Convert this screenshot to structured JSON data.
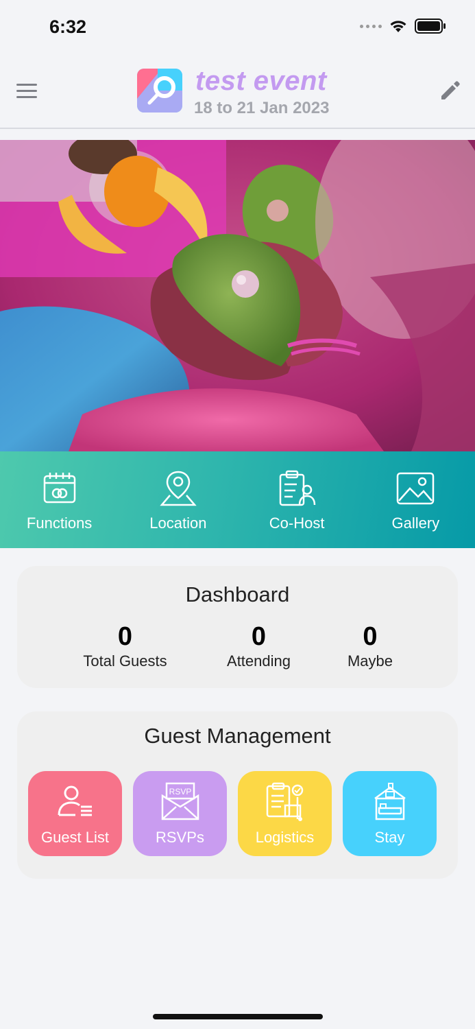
{
  "status_bar": {
    "time": "6:32",
    "icons": [
      "cellular-signal-icon",
      "wifi-icon",
      "battery-icon"
    ]
  },
  "header": {
    "title": "test event",
    "dates": "18 to 21 Jan 2023",
    "left_icon": "hamburger-menu-icon",
    "right_icon": "pencil-edit-icon",
    "logo_icon": "app-logo-icon",
    "title_color": "#c39af0"
  },
  "hero": {
    "icon": "wedding-photo-banner"
  },
  "quick_nav": {
    "items": [
      {
        "label": "Functions",
        "icon": "calendar-rings-icon"
      },
      {
        "label": "Location",
        "icon": "map-pin-icon"
      },
      {
        "label": "Co-Host",
        "icon": "clipboard-person-icon"
      },
      {
        "label": "Gallery",
        "icon": "image-icon"
      }
    ],
    "gradient": [
      "#4ec9ad",
      "#069aa7"
    ]
  },
  "dashboard": {
    "title": "Dashboard",
    "stats": [
      {
        "value": "0",
        "label": "Total Guests"
      },
      {
        "value": "0",
        "label": "Attending"
      },
      {
        "value": "0",
        "label": "Maybe"
      }
    ]
  },
  "guest_management": {
    "title": "Guest Management",
    "tiles": [
      {
        "label": "Guest List",
        "icon": "user-list-icon",
        "color": "#f7738a"
      },
      {
        "label": "RSVPs",
        "icon": "rsvp-envelope-icon",
        "color": "#c99cf0",
        "icon_text": "RSVP"
      },
      {
        "label": "Logistics",
        "icon": "logistics-clipboard-icon",
        "color": "#fcd846"
      },
      {
        "label": "Stay",
        "icon": "hotel-bed-icon",
        "color": "#47d1fc"
      }
    ]
  }
}
